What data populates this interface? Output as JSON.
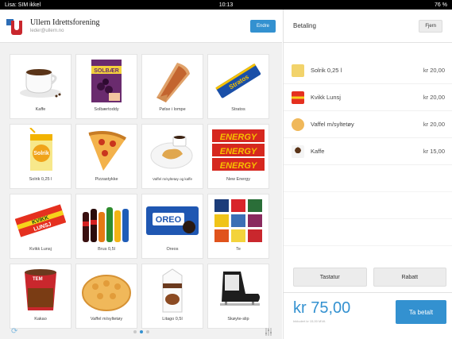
{
  "statusbar": {
    "carrier": "Lisa: SIM ikkel",
    "time": "10:13",
    "battery": "76 %"
  },
  "header": {
    "org_name": "Ullern Idrettsforening",
    "org_email": "leder@ullern.no",
    "edit_label": "Endre"
  },
  "products": [
    {
      "label": "Kaffe",
      "icon": "coffee-cup-icon"
    },
    {
      "label": "Solbærtoddy",
      "icon": "solbaer-box-icon"
    },
    {
      "label": "Pølse i lompe",
      "icon": "sausage-lompe-icon"
    },
    {
      "label": "Stratos",
      "icon": "stratos-bar-icon"
    },
    {
      "label": "Solrik 0,25 l",
      "icon": "juice-box-icon"
    },
    {
      "label": "Pizzastykke",
      "icon": "pizza-slice-icon"
    },
    {
      "label": "Vaffel m/syltetøy og kaffe",
      "icon": "waffle-coffee-icon"
    },
    {
      "label": "New Energy",
      "icon": "energy-bars-icon"
    },
    {
      "label": "Kvikk Lunsj",
      "icon": "kvikk-lunsj-icon"
    },
    {
      "label": "Brus 0,5l",
      "icon": "soda-bottles-icon"
    },
    {
      "label": "Oreos",
      "icon": "oreo-pack-icon"
    },
    {
      "label": "Te",
      "icon": "tea-boxes-icon"
    },
    {
      "label": "Kakao",
      "icon": "cocoa-cup-icon"
    },
    {
      "label": "Vaffel m/syltetøy",
      "icon": "waffle-icon"
    },
    {
      "label": "Litago 0,5l",
      "icon": "milk-carton-icon"
    },
    {
      "label": "Skøyte-slip",
      "icon": "ice-skate-icon"
    }
  ],
  "payment": {
    "title": "Betaling",
    "clear_label": "Fjern",
    "lines": [
      {
        "name": "Solrik 0,25 l",
        "price": "kr 20,00",
        "icon": "juice-box-icon"
      },
      {
        "name": "Kvikk Lunsj",
        "price": "kr 20,00",
        "icon": "kvikk-lunsj-icon"
      },
      {
        "name": "Vaffel m/syltetøy",
        "price": "kr 20,00",
        "icon": "waffle-icon"
      },
      {
        "name": "Kaffe",
        "price": "kr 15,00",
        "icon": "coffee-cup-icon"
      }
    ],
    "keypad_label": "Tastatur",
    "discount_label": "Rabatt",
    "total": "kr 75,00",
    "total_sub": "Inkludert kr 15,00 MVA",
    "pay_label": "Ta betalt"
  },
  "pager": {
    "pages": 3,
    "active": 1
  },
  "colors": {
    "accent": "#3391d0",
    "logo_red": "#c9272d",
    "logo_blue": "#2d6db5"
  }
}
